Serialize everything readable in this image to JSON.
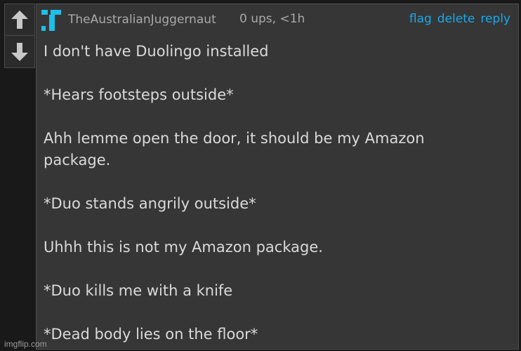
{
  "colors": {
    "background": "#191919",
    "comment_bg": "#363636",
    "text": "#dadada",
    "meta": "#a9a9a9",
    "link": "#1aa8ea",
    "avatar": "#1dbfe8"
  },
  "vote": {
    "up_icon": "arrow-up-icon",
    "down_icon": "arrow-down-icon"
  },
  "comment": {
    "avatar_icon": "user-avatar",
    "username": "TheAustralianJuggernaut",
    "meta": "0 ups, <1h",
    "actions": {
      "flag": "flag",
      "delete": "delete",
      "reply": "reply"
    },
    "lines": [
      "I don't have Duolingo installed",
      "",
      "*Hears footsteps outside*",
      "",
      "Ahh lemme open the door, it should be my Amazon",
      "package.",
      "",
      "*Duo stands angrily outside*",
      "",
      "Uhhh this is not my Amazon package.",
      "",
      "*Duo kills me with a knife",
      "",
      "*Dead body lies on the floor*"
    ]
  },
  "watermark": "imgflip.com"
}
